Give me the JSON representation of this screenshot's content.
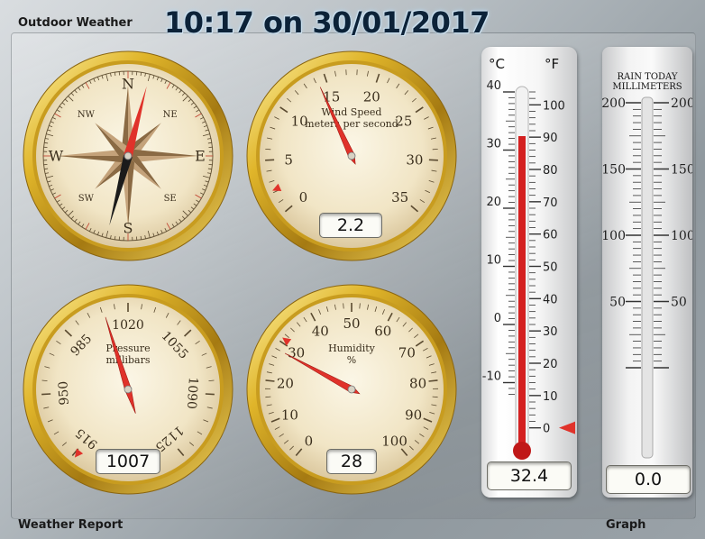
{
  "header": {
    "outdoor_title": "Outdoor Weather",
    "datetime": "10:17 on 30/01/2017",
    "report_title": "Weather Report",
    "graph_title": "Graph"
  },
  "compass": {
    "labels": {
      "n": "N",
      "ne": "NE",
      "e": "E",
      "se": "SE",
      "s": "S",
      "sw": "SW",
      "w": "W",
      "nw": "NW"
    },
    "needle_heading_deg": 15
  },
  "wind": {
    "label_line1": "Wind Speed",
    "label_line2": "meters per second",
    "scale": [
      "0",
      "5",
      "10",
      "15",
      "20",
      "25",
      "30",
      "35"
    ],
    "value": 2.2,
    "value_text": "2.2",
    "needle_value": 14.2,
    "min": 0,
    "max": 35
  },
  "pressure": {
    "label_line1": "Pressure",
    "label_line2": "millibars",
    "scale": [
      "915",
      "950",
      "985",
      "1020",
      "1055",
      "1090",
      "1125"
    ],
    "value": 1007,
    "value_text": "1007",
    "min": 915,
    "max": 1125
  },
  "humidity": {
    "label_line1": "Humidity",
    "label_line2": "%",
    "scale": [
      "0",
      "10",
      "20",
      "30",
      "40",
      "50",
      "60",
      "70",
      "80",
      "90",
      "100"
    ],
    "value": 28,
    "value_text": "28",
    "marker_value": 31,
    "min": 0,
    "max": 100
  },
  "temperature": {
    "celsius_unit": "°C",
    "fahrenheit_unit": "°F",
    "celsius_scale": [
      "40",
      "30",
      "20",
      "10",
      "0",
      "-10"
    ],
    "fahrenheit_scale": [
      "100",
      "90",
      "80",
      "70",
      "60",
      "50",
      "40",
      "30",
      "20",
      "10",
      "0"
    ],
    "value": 32.4,
    "value_text": "32.4",
    "marker_f": 0
  },
  "rain": {
    "title_line1": "RAIN TODAY",
    "title_line2": "MILLIMETERS",
    "scale": [
      "200",
      "150",
      "100",
      "50"
    ],
    "value": 0.0,
    "value_text": "0.0"
  },
  "colors": {
    "gold": "#d4a91e",
    "dial_face": "#f4ead0",
    "needle_red": "#e0322a",
    "mercury": "#d42020"
  }
}
